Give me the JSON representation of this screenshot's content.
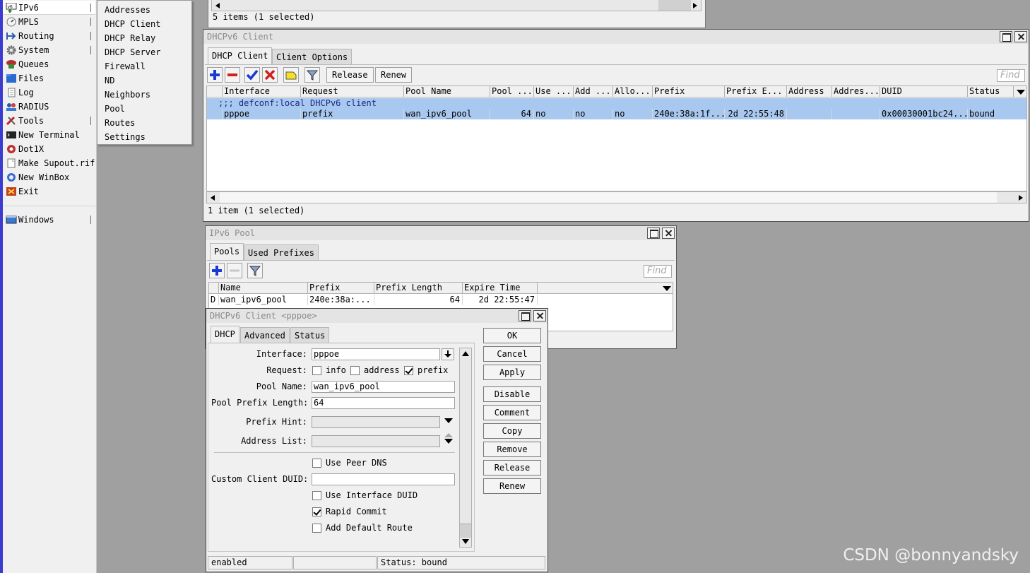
{
  "sidebar": {
    "items": [
      {
        "label": "IPv6",
        "icon": "ipv6-icon",
        "submenu": true
      },
      {
        "label": "MPLS",
        "icon": "mpls-icon",
        "submenu": true
      },
      {
        "label": "Routing",
        "icon": "routing-icon",
        "submenu": true
      },
      {
        "label": "System",
        "icon": "system-gear-icon",
        "submenu": true
      },
      {
        "label": "Queues",
        "icon": "queues-icon",
        "submenu": false
      },
      {
        "label": "Files",
        "icon": "folder-icon",
        "submenu": false
      },
      {
        "label": "Log",
        "icon": "log-icon",
        "submenu": false
      },
      {
        "label": "RADIUS",
        "icon": "radius-icon",
        "submenu": false
      },
      {
        "label": "Tools",
        "icon": "tools-icon",
        "submenu": true
      },
      {
        "label": "New Terminal",
        "icon": "terminal-icon",
        "submenu": false
      },
      {
        "label": "Dot1X",
        "icon": "dot1x-icon",
        "submenu": false
      },
      {
        "label": "Make Supout.rif",
        "icon": "supout-icon",
        "submenu": false
      },
      {
        "label": "New WinBox",
        "icon": "winbox-icon",
        "submenu": false
      },
      {
        "label": "Exit",
        "icon": "exit-icon",
        "submenu": false
      }
    ],
    "windows_label": "Windows"
  },
  "ipv6_submenu": [
    "Addresses",
    "DHCP Client",
    "DHCP Relay",
    "DHCP Server",
    "Firewall",
    "ND",
    "Neighbors",
    "Pool",
    "Routes",
    "Settings"
  ],
  "top_window": {
    "status": "5 items (1 selected)"
  },
  "dhcpv6_client_window": {
    "title": "DHCPv6 Client",
    "tabs": [
      "DHCP Client",
      "Client Options"
    ],
    "toolbar": {
      "release": "Release",
      "renew": "Renew",
      "find": "Find"
    },
    "columns": [
      "Interface",
      "Request",
      "Pool Name",
      "Pool ...",
      "Use ...",
      "Add ...",
      "Allo...",
      "Prefix",
      "Prefix E...",
      "Address",
      "Addres...",
      "DUID",
      "Status"
    ],
    "comment_row": ";;; defconf:local DHCPv6 client",
    "row": {
      "interface": "pppoe",
      "request": "prefix",
      "pool_name": "wan_ipv6_pool",
      "pool_len": "64",
      "use": "no",
      "add": "no",
      "allo": "no",
      "prefix": "240e:38a:1f...",
      "prefix_exp": "2d 22:55:48",
      "address": "",
      "address2": "",
      "duid": "0x00030001bc24...",
      "status": "bound"
    },
    "status": "1 item (1 selected)"
  },
  "ipv6_pool_window": {
    "title": "IPv6 Pool",
    "tabs": [
      "Pools",
      "Used Prefixes"
    ],
    "find": "Find",
    "columns": [
      "Name",
      "Prefix",
      "Prefix Length",
      "Expire Time"
    ],
    "row": {
      "flag": "D",
      "name": "wan_ipv6_pool",
      "prefix": "240e:38a:...",
      "prefix_length": "64",
      "expire_time": "2d 22:55:47"
    }
  },
  "dhcp_dialog": {
    "title": "DHCPv6 Client <pppoe>",
    "tabs": [
      "DHCP",
      "Advanced",
      "Status"
    ],
    "labels": {
      "interface": "Interface:",
      "request": "Request:",
      "pool_name": "Pool Name:",
      "pool_prefix_length": "Pool Prefix Length:",
      "prefix_hint": "Prefix Hint:",
      "address_list": "Address List:",
      "custom_duid": "Custom Client DUID:"
    },
    "values": {
      "interface": "pppoe",
      "pool_name": "wan_ipv6_pool",
      "pool_prefix_length": "64",
      "prefix_hint": "",
      "address_list": "",
      "custom_duid": ""
    },
    "request_options": [
      {
        "label": "info",
        "checked": false
      },
      {
        "label": "address",
        "checked": false
      },
      {
        "label": "prefix",
        "checked": true
      }
    ],
    "checkboxes": [
      {
        "label": "Use Peer DNS",
        "checked": false
      },
      {
        "label": "Use Interface DUID",
        "checked": false
      },
      {
        "label": "Rapid Commit",
        "checked": true
      },
      {
        "label": "Add Default Route",
        "checked": false
      }
    ],
    "buttons": [
      "OK",
      "Cancel",
      "Apply",
      "Disable",
      "Comment",
      "Copy",
      "Remove",
      "Release",
      "Renew"
    ],
    "status": {
      "state": "enabled",
      "middle": "",
      "status": "Status: bound"
    }
  },
  "watermark": "CSDN @bonnyandsky"
}
